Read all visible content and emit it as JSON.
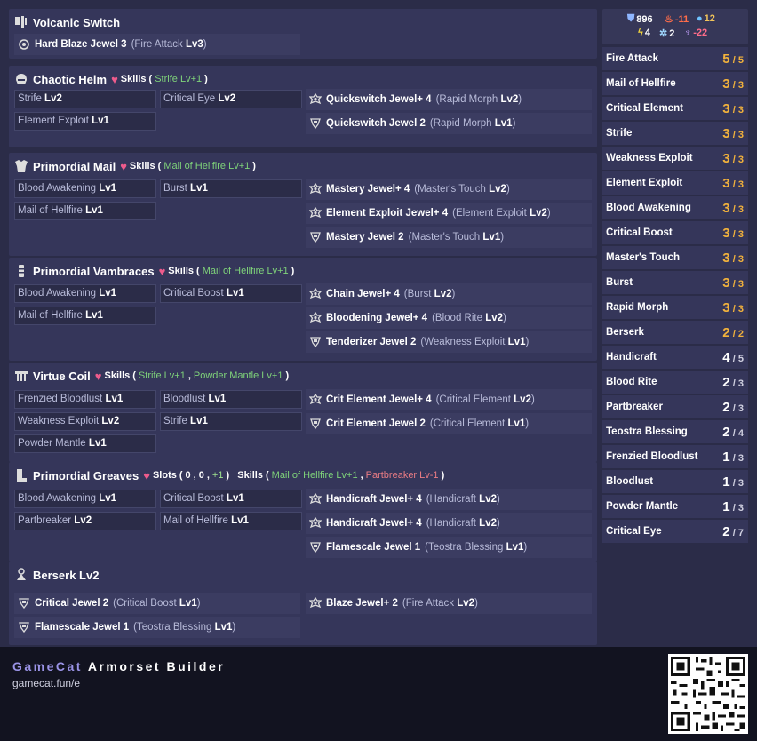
{
  "weapon": {
    "name": "Volcanic Switch",
    "jewels": [
      {
        "name": "Hard Blaze Jewel 3",
        "skill": "Fire Attack",
        "lv": "Lv3"
      }
    ]
  },
  "helm": {
    "name": "Chaotic Helm",
    "skills_label": "Skills",
    "set_skills": [
      {
        "text": "Strife Lv+1",
        "tone": "green"
      }
    ],
    "skills": [
      {
        "name": "Strife",
        "lv": "Lv2"
      },
      {
        "name": "Critical Eye",
        "lv": "Lv2"
      },
      {
        "name": "Element Exploit",
        "lv": "Lv1"
      }
    ],
    "jewels": [
      {
        "name": "Quickswitch Jewel+ 4",
        "skill": "Rapid Morph",
        "lv": "Lv2"
      },
      {
        "name": "Quickswitch Jewel 2",
        "skill": "Rapid Morph",
        "lv": "Lv1"
      }
    ]
  },
  "mail": {
    "name": "Primordial Mail",
    "skills_label": "Skills",
    "set_skills": [
      {
        "text": "Mail of Hellfire Lv+1",
        "tone": "green"
      }
    ],
    "skills": [
      {
        "name": "Blood Awakening",
        "lv": "Lv1"
      },
      {
        "name": "Burst",
        "lv": "Lv1"
      },
      {
        "name": "Mail of Hellfire",
        "lv": "Lv1"
      }
    ],
    "jewels": [
      {
        "name": "Mastery Jewel+ 4",
        "skill": "Master's Touch",
        "lv": "Lv2"
      },
      {
        "name": "Element Exploit Jewel+ 4",
        "skill": "Element Exploit",
        "lv": "Lv2"
      },
      {
        "name": "Mastery Jewel 2",
        "skill": "Master's Touch",
        "lv": "Lv1"
      }
    ]
  },
  "vambraces": {
    "name": "Primordial Vambraces",
    "skills_label": "Skills",
    "set_skills": [
      {
        "text": "Mail of Hellfire Lv+1",
        "tone": "green"
      }
    ],
    "skills": [
      {
        "name": "Blood Awakening",
        "lv": "Lv1"
      },
      {
        "name": "Critical Boost",
        "lv": "Lv1"
      },
      {
        "name": "Mail of Hellfire",
        "lv": "Lv1"
      }
    ],
    "jewels": [
      {
        "name": "Chain Jewel+ 4",
        "skill": "Burst",
        "lv": "Lv2"
      },
      {
        "name": "Bloodening Jewel+ 4",
        "skill": "Blood Rite",
        "lv": "Lv2"
      },
      {
        "name": "Tenderizer Jewel 2",
        "skill": "Weakness Exploit",
        "lv": "Lv1"
      }
    ]
  },
  "coil": {
    "name": "Virtue Coil",
    "skills_label": "Skills",
    "set_skills": [
      {
        "text": "Strife Lv+1",
        "tone": "green"
      },
      {
        "text": "Powder Mantle Lv+1",
        "tone": "green"
      }
    ],
    "skills": [
      {
        "name": "Frenzied Bloodlust",
        "lv": "Lv1"
      },
      {
        "name": "Bloodlust",
        "lv": "Lv1"
      },
      {
        "name": "Weakness Exploit",
        "lv": "Lv2"
      },
      {
        "name": "Strife",
        "lv": "Lv1"
      },
      {
        "name": "Powder Mantle",
        "lv": "Lv1"
      }
    ],
    "jewels": [
      {
        "name": "Crit Element Jewel+ 4",
        "skill": "Critical Element",
        "lv": "Lv2"
      },
      {
        "name": "Crit Element Jewel 2",
        "skill": "Critical Element",
        "lv": "Lv1"
      }
    ]
  },
  "greaves": {
    "name": "Primordial Greaves",
    "slots_label": "Slots",
    "slots": [
      "0",
      "0",
      "+1"
    ],
    "skills_label": "Skills",
    "set_skills": [
      {
        "text": "Mail of Hellfire Lv+1",
        "tone": "green"
      },
      {
        "text": "Partbreaker Lv-1",
        "tone": "red"
      }
    ],
    "skills": [
      {
        "name": "Blood Awakening",
        "lv": "Lv1"
      },
      {
        "name": "Critical Boost",
        "lv": "Lv1"
      },
      {
        "name": "Partbreaker",
        "lv": "Lv2"
      },
      {
        "name": "Mail of Hellfire",
        "lv": "Lv1"
      }
    ],
    "jewels": [
      {
        "name": "Handicraft Jewel+ 4",
        "skill": "Handicraft",
        "lv": "Lv2"
      },
      {
        "name": "Handicraft Jewel+ 4",
        "skill": "Handicraft",
        "lv": "Lv2"
      },
      {
        "name": "Flamescale Jewel 1",
        "skill": "Teostra Blessing",
        "lv": "Lv1"
      }
    ]
  },
  "charm": {
    "name": "Berserk Lv2",
    "jewels": [
      {
        "name": "Critical Jewel 2",
        "skill": "Critical Boost",
        "lv": "Lv1"
      },
      {
        "name": "Blaze Jewel+ 2",
        "skill": "Fire Attack",
        "lv": "Lv2"
      },
      {
        "name": "Flamescale Jewel 1",
        "skill": "Teostra Blessing",
        "lv": "Lv1"
      }
    ]
  },
  "stats": {
    "defense": "896",
    "fire": "-11",
    "water": "12",
    "thunder": "4",
    "ice": "2",
    "dragon": "-22"
  },
  "skill_summary": [
    {
      "name": "Fire Attack",
      "level": "5",
      "max": "/ 5",
      "color": "#f2b23c"
    },
    {
      "name": "Mail of Hellfire",
      "level": "3",
      "max": "/ 3",
      "color": "#f2b23c"
    },
    {
      "name": "Critical Element",
      "level": "3",
      "max": "/ 3",
      "color": "#f2b23c"
    },
    {
      "name": "Strife",
      "level": "3",
      "max": "/ 3",
      "color": "#f2b23c"
    },
    {
      "name": "Weakness Exploit",
      "level": "3",
      "max": "/ 3",
      "color": "#f2b23c"
    },
    {
      "name": "Element Exploit",
      "level": "3",
      "max": "/ 3",
      "color": "#f2b23c"
    },
    {
      "name": "Blood Awakening",
      "level": "3",
      "max": "/ 3",
      "color": "#f2b23c"
    },
    {
      "name": "Critical Boost",
      "level": "3",
      "max": "/ 3",
      "color": "#f2b23c"
    },
    {
      "name": "Master's Touch",
      "level": "3",
      "max": "/ 3",
      "color": "#f2b23c"
    },
    {
      "name": "Burst",
      "level": "3",
      "max": "/ 3",
      "color": "#f2b23c"
    },
    {
      "name": "Rapid Morph",
      "level": "3",
      "max": "/ 3",
      "color": "#f2b23c"
    },
    {
      "name": "Berserk",
      "level": "2",
      "max": "/ 2",
      "color": "#f2b23c"
    },
    {
      "name": "Handicraft",
      "level": "4",
      "max": "/ 5",
      "color": "#ffffff"
    },
    {
      "name": "Blood Rite",
      "level": "2",
      "max": "/ 3",
      "color": "#ffffff"
    },
    {
      "name": "Partbreaker",
      "level": "2",
      "max": "/ 3",
      "color": "#ffffff"
    },
    {
      "name": "Teostra Blessing",
      "level": "2",
      "max": "/ 4",
      "color": "#ffffff"
    },
    {
      "name": "Frenzied Bloodlust",
      "level": "1",
      "max": "/ 3",
      "color": "#ffffff"
    },
    {
      "name": "Bloodlust",
      "level": "1",
      "max": "/ 3",
      "color": "#ffffff"
    },
    {
      "name": "Powder Mantle",
      "level": "1",
      "max": "/ 3",
      "color": "#ffffff"
    },
    {
      "name": "Critical Eye",
      "level": "2",
      "max": "/ 7",
      "color": "#ffffff"
    }
  ],
  "footer": {
    "brand_a": "GameCat",
    "brand_b": "Armorset Builder",
    "url": "gamecat.fun/e"
  },
  "colors": {
    "gold": "#f2b23c",
    "accent": "#9a93e6",
    "set_green": "#7fd37a",
    "set_red": "#ea7c84"
  }
}
